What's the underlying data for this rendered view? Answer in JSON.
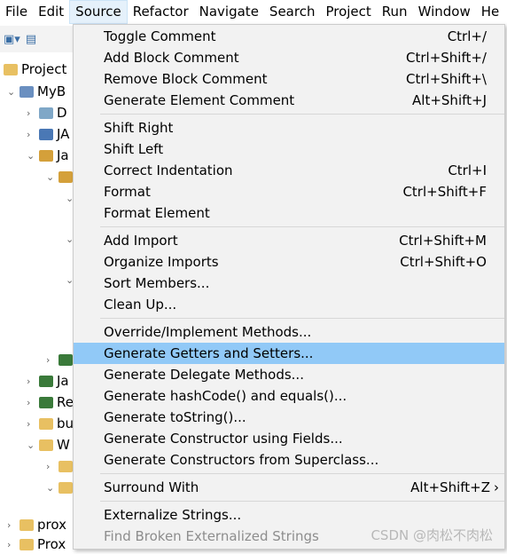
{
  "menubar": [
    "File",
    "Edit",
    "Source",
    "Refactor",
    "Navigate",
    "Search",
    "Project",
    "Run",
    "Window",
    "He"
  ],
  "explorer": {
    "title": "Project",
    "rows": [
      {
        "label": "MyB",
        "twisty": "v",
        "indent": 0,
        "color": "#6a8fc0"
      },
      {
        "label": "D",
        "twisty": ">",
        "indent": 1,
        "color": "#7fa7c7"
      },
      {
        "label": "JA",
        "twisty": ">",
        "indent": 1,
        "color": "#4a78b5"
      },
      {
        "label": "Ja",
        "twisty": "v",
        "indent": 1,
        "color": "#d4a03a"
      },
      {
        "label": "",
        "twisty": "v",
        "indent": 2,
        "color": "#d4a03a"
      },
      {
        "label": "",
        "twisty": "v",
        "indent": 3,
        "color": ""
      },
      {
        "label": "",
        "twisty": "v",
        "indent": 3,
        "color": ""
      },
      {
        "label": "",
        "twisty": "v",
        "indent": 3,
        "color": ""
      },
      {
        "label": "",
        "twisty": ">",
        "indent": 2,
        "color": "#3a7a3a"
      },
      {
        "label": "Ja",
        "twisty": ">",
        "indent": 1,
        "color": "#3a7a3a"
      },
      {
        "label": "Re",
        "twisty": ">",
        "indent": 1,
        "color": "#3a7a3a"
      },
      {
        "label": "bu",
        "twisty": ">",
        "indent": 1,
        "color": "#e8c062"
      },
      {
        "label": "W",
        "twisty": "v",
        "indent": 1,
        "color": "#e8c062"
      },
      {
        "label": "",
        "twisty": ">",
        "indent": 2,
        "color": "#e8c062"
      },
      {
        "label": "",
        "twisty": "v",
        "indent": 2,
        "color": "#e8c062"
      },
      {
        "label": "prox",
        "twisty": ">",
        "indent": 0,
        "color": "#e8c062"
      },
      {
        "label": "Prox",
        "twisty": ">",
        "indent": 0,
        "color": "#e8c062"
      }
    ]
  },
  "menu": {
    "groups": [
      [
        {
          "label": "Toggle Comment",
          "shortcut": "Ctrl+/"
        },
        {
          "label": "Add Block Comment",
          "shortcut": "Ctrl+Shift+/"
        },
        {
          "label": "Remove Block Comment",
          "shortcut": "Ctrl+Shift+\\"
        },
        {
          "label": "Generate Element Comment",
          "shortcut": "Alt+Shift+J"
        }
      ],
      [
        {
          "label": "Shift Right",
          "shortcut": ""
        },
        {
          "label": "Shift Left",
          "shortcut": ""
        },
        {
          "label": "Correct Indentation",
          "shortcut": "Ctrl+I"
        },
        {
          "label": "Format",
          "shortcut": "Ctrl+Shift+F"
        },
        {
          "label": "Format Element",
          "shortcut": ""
        }
      ],
      [
        {
          "label": "Add Import",
          "shortcut": "Ctrl+Shift+M"
        },
        {
          "label": "Organize Imports",
          "shortcut": "Ctrl+Shift+O"
        },
        {
          "label": "Sort Members...",
          "shortcut": ""
        },
        {
          "label": "Clean Up...",
          "shortcut": ""
        }
      ],
      [
        {
          "label": "Override/Implement Methods...",
          "shortcut": ""
        },
        {
          "label": "Generate Getters and Setters...",
          "shortcut": "",
          "highlighted": true
        },
        {
          "label": "Generate Delegate Methods...",
          "shortcut": ""
        },
        {
          "label": "Generate hashCode() and equals()...",
          "shortcut": ""
        },
        {
          "label": "Generate toString()...",
          "shortcut": ""
        },
        {
          "label": "Generate Constructor using Fields...",
          "shortcut": ""
        },
        {
          "label": "Generate Constructors from Superclass...",
          "shortcut": ""
        }
      ],
      [
        {
          "label": "Surround With",
          "shortcut": "Alt+Shift+Z",
          "submenu": true
        }
      ],
      [
        {
          "label": "Externalize Strings...",
          "shortcut": ""
        },
        {
          "label": "Find Broken Externalized Strings",
          "shortcut": "",
          "disabled": true
        }
      ]
    ]
  },
  "watermark": "CSDN @肉松不肉松",
  "colors": {
    "highlight": "#91c9f7",
    "menu_bg": "#f2f2f2",
    "active_menubar": "#e5f1fb"
  }
}
